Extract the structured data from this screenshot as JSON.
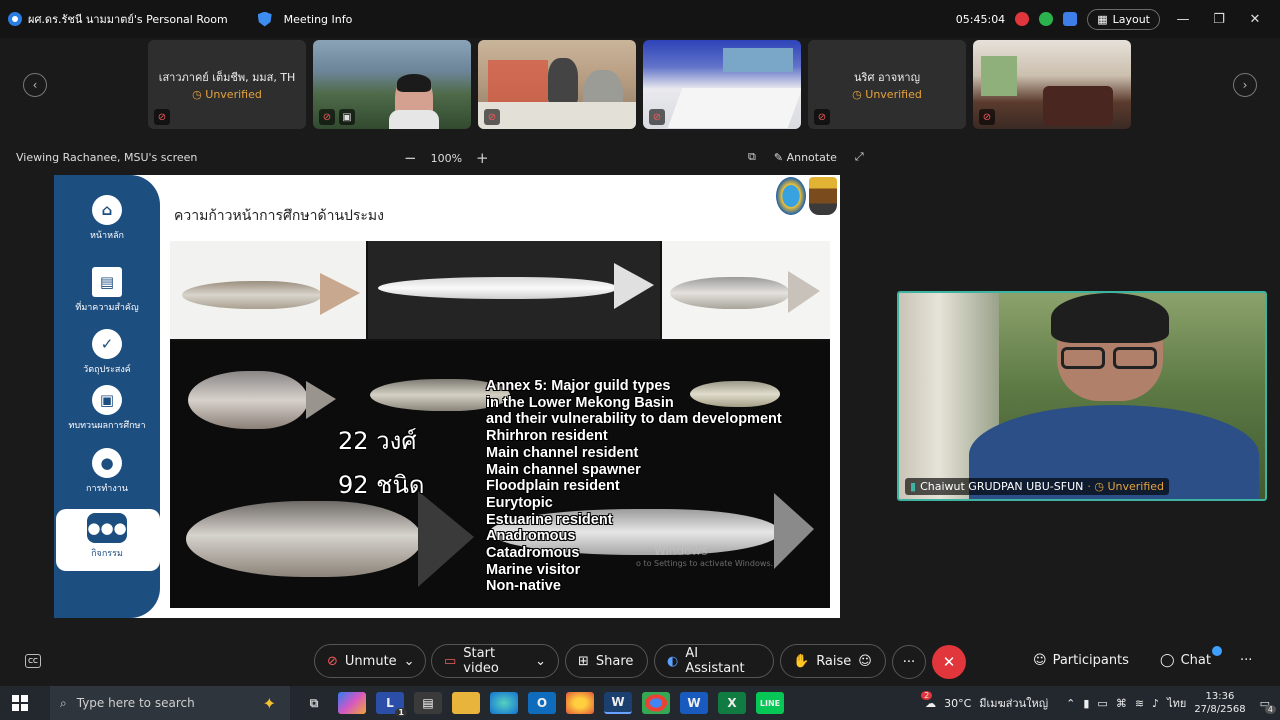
{
  "titlebar": {
    "room_name": "ผศ.ดร.รัชนี นามมาตย์'s Personal Room",
    "meeting_info": "Meeting Info",
    "time": "05:45:04",
    "layout_label": "Layout"
  },
  "participants": [
    {
      "name": "เสาวภาคย์ เต็มชีพ, มมส, TH",
      "status": "Unverified",
      "video": false
    },
    {
      "name": "",
      "status": "",
      "video": true
    },
    {
      "name": "",
      "status": "",
      "video": true
    },
    {
      "name": "",
      "status": "",
      "video": true
    },
    {
      "name": "นริศ อาจหาญ",
      "status": "Unverified",
      "video": false
    },
    {
      "name": "",
      "status": "",
      "video": true
    }
  ],
  "share": {
    "viewing_label": "Viewing Rachanee, MSU's screen",
    "zoom": "100%",
    "zoom_out": "−",
    "zoom_in": "+",
    "annotate_label": "Annotate"
  },
  "slide": {
    "title": "ความก้าวหน้าการศึกษาด้านประมง",
    "nav": [
      {
        "label": "หน้าหลัก",
        "icon": "home-icon"
      },
      {
        "label": "ที่มาความสำคัญ",
        "icon": "id-card-icon"
      },
      {
        "label": "วัตถุประสงค์",
        "icon": "check-circle-icon"
      },
      {
        "label": "ทบทวนผลการศึกษา",
        "icon": "briefcase-icon"
      },
      {
        "label": "การทำงาน",
        "icon": "user-icon"
      },
      {
        "label": "กิจกรรม",
        "icon": "group-icon"
      }
    ],
    "count_families": "22 วงศ์",
    "count_species": "92 ชนิด",
    "annex_lines": [
      "Annex 5: Major guild types",
      "in the Lower Mekong Basin",
      "and their vulnerability to dam development",
      "Rhirhron resident",
      "Main channel resident",
      "Main channel spawner",
      "Floodplain resident",
      "Eurytopic",
      "Estuarine resident",
      "Anadromous",
      "Catadromous",
      "Marine visitor",
      "Non-native"
    ],
    "watermark_line1": "Windows",
    "watermark_line2": "o to Settings to activate Windows."
  },
  "speaker": {
    "name": "Chaiwut GRUDPAN UBU-SFUN",
    "status": "Unverified"
  },
  "controls": {
    "unmute": "Unmute",
    "start_video": "Start video",
    "share": "Share",
    "ai_assistant": "AI Assistant",
    "raise": "Raise",
    "participants": "Participants",
    "chat": "Chat"
  },
  "taskbar": {
    "search_placeholder": "Type here to search",
    "weather_temp": "30°C",
    "weather_place": "มีเมฆส่วนใหญ่",
    "weather_badge": "2",
    "lang": "ไทย",
    "clock_time": "13:36",
    "clock_date": "27/8/2568",
    "notif_count": "4",
    "app_badge": "1"
  },
  "colors": {
    "accent_teal": "#3fb3a2",
    "end_call": "#e0363c",
    "warning": "#e6a23c",
    "slide_nav": "#1d4e80"
  }
}
